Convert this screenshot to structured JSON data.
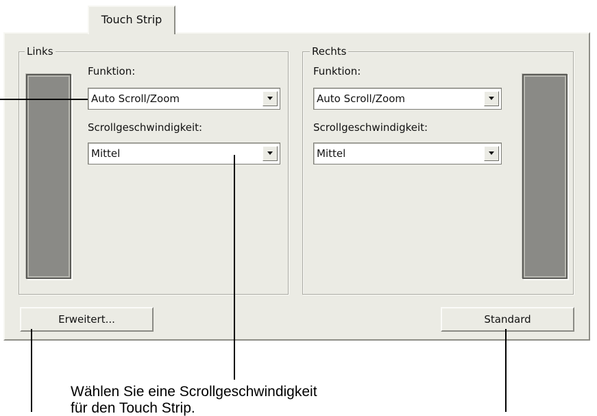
{
  "tab": {
    "label": "Touch Strip"
  },
  "left_group": {
    "title": "Links",
    "function_label": "Funktion:",
    "function_value": "Auto Scroll/Zoom",
    "speed_label": "Scrollgeschwindigkeit:",
    "speed_value": "Mittel"
  },
  "right_group": {
    "title": "Rechts",
    "function_label": "Funktion:",
    "function_value": "Auto Scroll/Zoom",
    "speed_label": "Scrollgeschwindigkeit:",
    "speed_value": "Mittel"
  },
  "buttons": {
    "advanced": "Erweitert...",
    "default": "Standard"
  },
  "caption": {
    "line1": "Wählen Sie eine Scrollgeschwindigkeit",
    "line2": "für den Touch Strip."
  }
}
